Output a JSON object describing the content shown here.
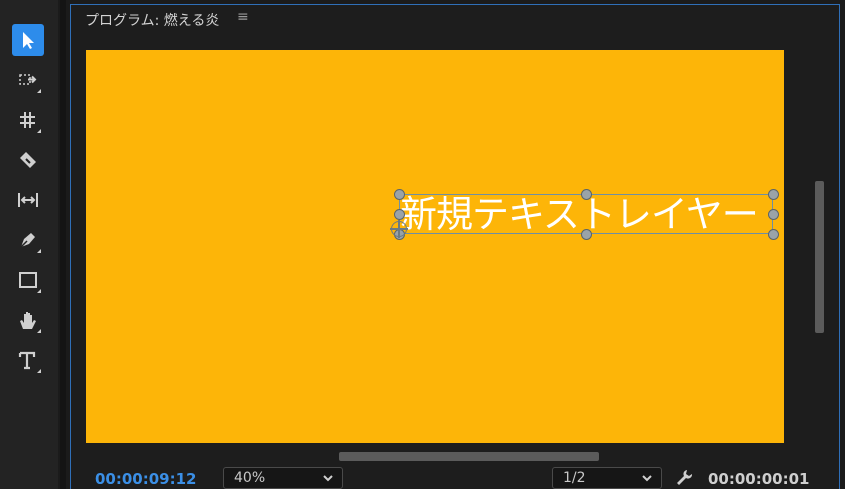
{
  "panel": {
    "title": "プログラム: 燃える炎",
    "menu_icon": "≡"
  },
  "tools": [
    {
      "name": "selection-tool",
      "icon": "arrow-icon",
      "active": true
    },
    {
      "name": "track-select-tool",
      "icon": "track-select-icon"
    },
    {
      "name": "ripple-edit-tool",
      "icon": "ripple-edit-icon"
    },
    {
      "name": "razor-tool",
      "icon": "razor-icon"
    },
    {
      "name": "slip-tool",
      "icon": "slip-icon"
    },
    {
      "name": "pen-tool",
      "icon": "pen-icon"
    },
    {
      "name": "rectangle-tool",
      "icon": "rectangle-icon"
    },
    {
      "name": "hand-tool",
      "icon": "hand-icon"
    },
    {
      "name": "type-tool",
      "icon": "type-icon"
    }
  ],
  "canvas": {
    "background": "#fdb508",
    "text_layer": "新規テキストレイヤー"
  },
  "controls": {
    "current_timecode": "00:00:09:12",
    "zoom_level": "40%",
    "resolution": "1/2",
    "duration_timecode": "00:00:00:01"
  },
  "colors": {
    "accent": "#2d8ceb",
    "timecode": "#3b8fe6"
  }
}
